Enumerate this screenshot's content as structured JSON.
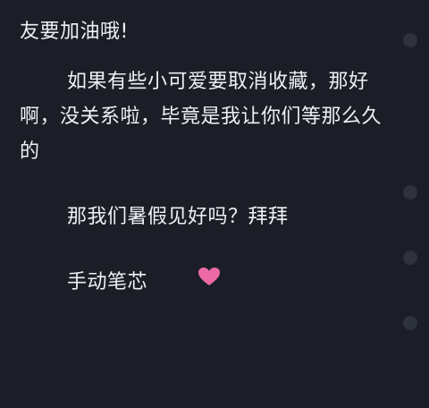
{
  "paragraphs": [
    {
      "text": "友要加油哦!"
    },
    {
      "text": "如果有些小可爱要取消收藏，那好啊，没关系啦，毕竟是我让你们等那么久的"
    },
    {
      "text": "那我们暑假见好吗？拜拜"
    },
    {
      "text": "手动笔芯"
    }
  ],
  "heart_emoji": "heart-icon",
  "colors": {
    "background": "#1b1e27",
    "text": "#eef0f4",
    "heart": "#ee6aa7",
    "dot": "#2e323b"
  }
}
